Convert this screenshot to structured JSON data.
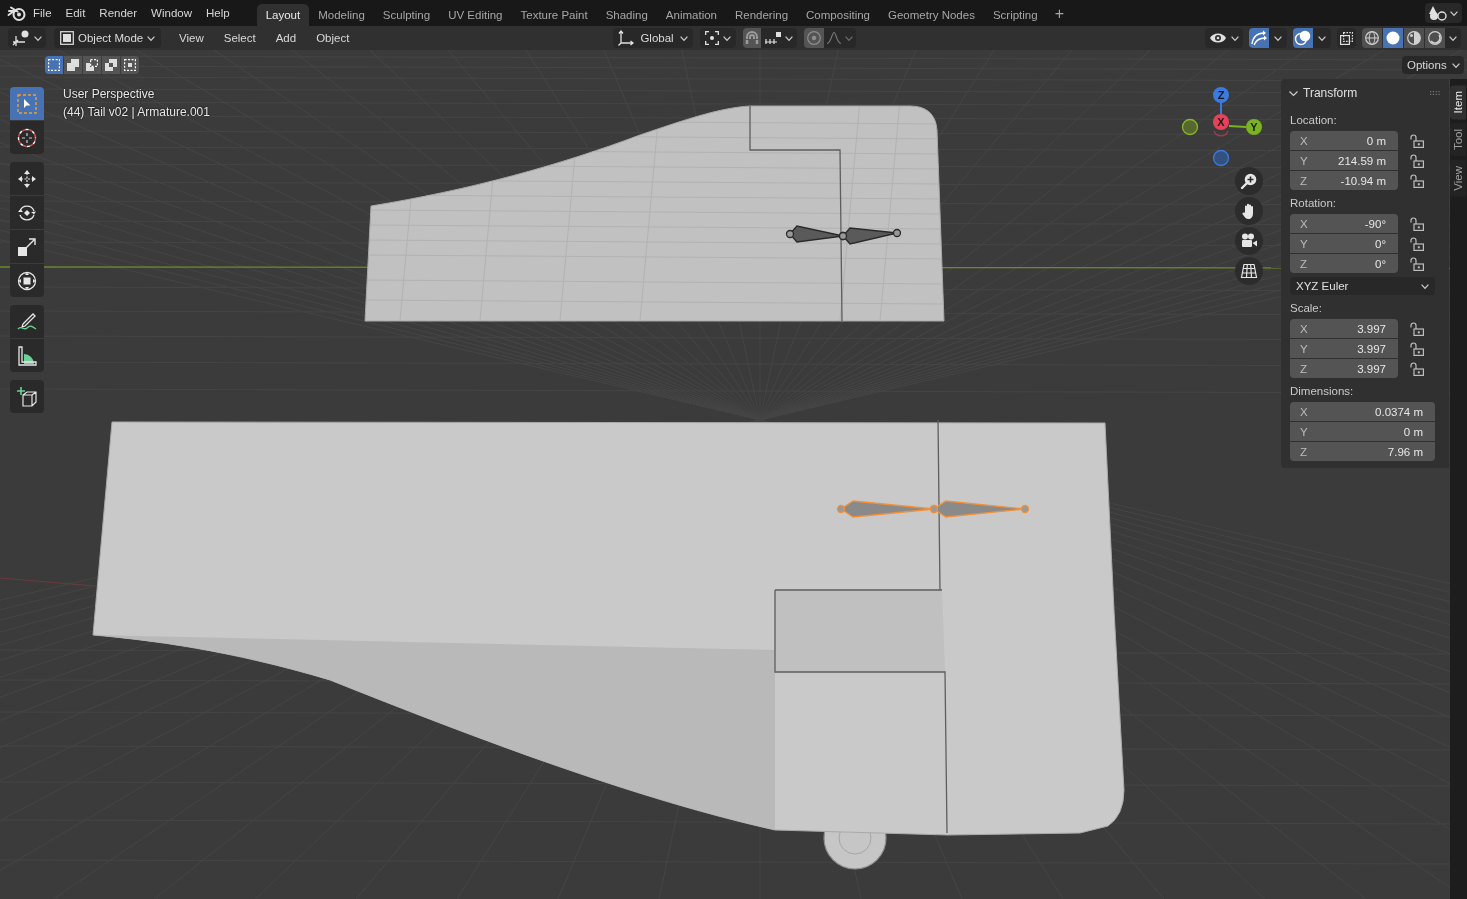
{
  "topbar": {
    "menus": [
      "File",
      "Edit",
      "Render",
      "Window",
      "Help"
    ],
    "workspaces": [
      {
        "label": "Layout",
        "selected": true
      },
      {
        "label": "Modeling",
        "selected": false
      },
      {
        "label": "Sculpting",
        "selected": false
      },
      {
        "label": "UV Editing",
        "selected": false
      },
      {
        "label": "Texture Paint",
        "selected": false
      },
      {
        "label": "Shading",
        "selected": false
      },
      {
        "label": "Animation",
        "selected": false
      },
      {
        "label": "Rendering",
        "selected": false
      },
      {
        "label": "Compositing",
        "selected": false
      },
      {
        "label": "Geometry Nodes",
        "selected": false
      },
      {
        "label": "Scripting",
        "selected": false
      }
    ],
    "add_workspace": "+"
  },
  "header": {
    "mode": "Object Mode",
    "menus": [
      "View",
      "Select",
      "Add",
      "Object"
    ],
    "orientation": "Global",
    "snap": {
      "on": false
    },
    "proportional_editing": {
      "on": false
    },
    "gizmos": {
      "on": true
    },
    "overlays": {
      "on": true
    },
    "xray": {
      "on": false
    },
    "shading": [
      {
        "kind": "wireframe",
        "selected": false
      },
      {
        "kind": "solid",
        "selected": true
      },
      {
        "kind": "material",
        "selected": false
      },
      {
        "kind": "rendered",
        "selected": false
      }
    ]
  },
  "tool_settings": {
    "selection_modes": [
      {
        "kind": "set",
        "selected": true
      },
      {
        "kind": "extend",
        "selected": false
      },
      {
        "kind": "subtract",
        "selected": false
      },
      {
        "kind": "invert",
        "selected": false
      },
      {
        "kind": "intersect",
        "selected": false
      }
    ],
    "options": "Options"
  },
  "toolbar": {
    "groups": [
      {
        "tools": [
          {
            "kind": "select_box",
            "selected": true
          },
          {
            "kind": "cursor",
            "selected": false
          }
        ]
      },
      {
        "tools": [
          {
            "kind": "move",
            "selected": false
          },
          {
            "kind": "rotate",
            "selected": false
          },
          {
            "kind": "scale",
            "selected": false
          },
          {
            "kind": "transform",
            "selected": false
          }
        ]
      },
      {
        "tools": [
          {
            "kind": "annotate",
            "selected": false
          },
          {
            "kind": "measure",
            "selected": false
          }
        ]
      },
      {
        "tools": [
          {
            "kind": "add_cube",
            "selected": false
          }
        ]
      }
    ]
  },
  "viewport": {
    "view_name": "User Perspective",
    "object_info": "(44) Tail v02 | Armature.001"
  },
  "scene": {
    "armatures": [
      {
        "selected": false
      },
      {
        "selected": true
      }
    ]
  },
  "navigation_gizmo": {
    "axes": [
      {
        "label": "Z"
      },
      {
        "label": "X"
      },
      {
        "label": "Y"
      }
    ]
  },
  "sidebar": {
    "tabs": [
      {
        "label": "Item",
        "selected": true
      },
      {
        "label": "Tool",
        "selected": false
      },
      {
        "label": "View",
        "selected": false
      }
    ],
    "panel": {
      "title": "Transform",
      "expanded": true,
      "groups": [
        {
          "label": "Location:",
          "fields": [
            {
              "axis": "X",
              "value": "0 m",
              "locked": false
            },
            {
              "axis": "Y",
              "value": "214.59 m",
              "locked": false
            },
            {
              "axis": "Z",
              "value": "-10.94 m",
              "locked": false
            }
          ]
        },
        {
          "label": "Rotation:",
          "fields": [
            {
              "axis": "X",
              "value": "-90°",
              "locked": false
            },
            {
              "axis": "Y",
              "value": "0°",
              "locked": false
            },
            {
              "axis": "Z",
              "value": "0°",
              "locked": false
            }
          ],
          "mode": "XYZ Euler"
        },
        {
          "label": "Scale:",
          "fields": [
            {
              "axis": "X",
              "value": "3.997",
              "locked": false
            },
            {
              "axis": "Y",
              "value": "3.997",
              "locked": false
            },
            {
              "axis": "Z",
              "value": "3.997",
              "locked": false
            }
          ]
        },
        {
          "label": "Dimensions:",
          "fields": [
            {
              "axis": "X",
              "value": "0.0374 m"
            },
            {
              "axis": "Y",
              "value": "0 m"
            },
            {
              "axis": "Z",
              "value": "7.96 m"
            }
          ]
        }
      ]
    }
  }
}
